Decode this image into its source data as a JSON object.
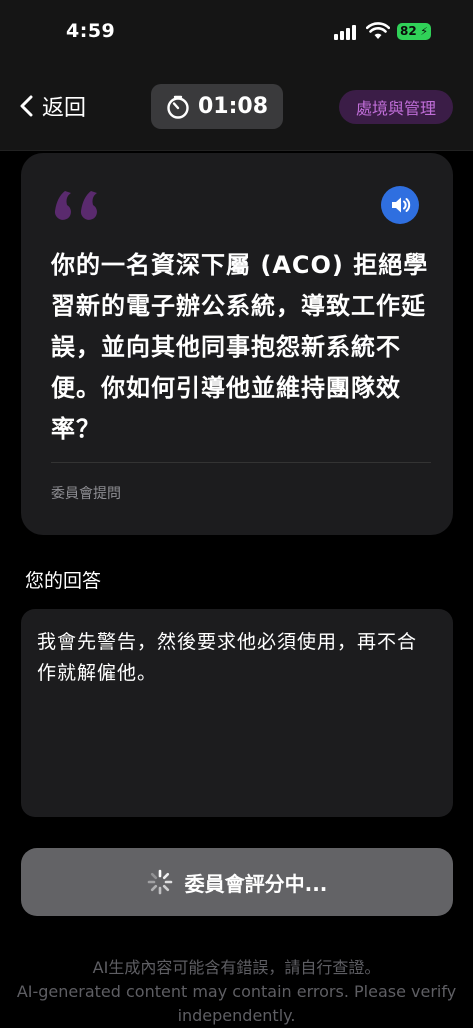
{
  "status_bar": {
    "time": "4:59",
    "battery": "82"
  },
  "nav": {
    "back_label": "返回",
    "timer": "01:08",
    "manage_label": "處境與管理"
  },
  "question_card": {
    "text": "你的一名資深下屬 (ACO) 拒絕學習新的電子辦公系統，導致工作延誤，並向其他同事抱怨新系統不便。你如何引導他並維持團隊效率？",
    "source": "委員會提問"
  },
  "answer": {
    "label": "您的回答",
    "text": "我會先警告，然後要求他必須使用，再不合作就解僱他。"
  },
  "submit": {
    "label": "委員會評分中..."
  },
  "footer": {
    "zh": "AI生成內容可能含有錯誤，請自行查證。",
    "en": "AI-generated content may contain errors. Please verify independently."
  },
  "colors": {
    "accent_purple": "#c06ed8",
    "speaker_blue": "#2f6fe0",
    "quote_purple": "#5a2a6e",
    "battery_green": "#30d158"
  }
}
